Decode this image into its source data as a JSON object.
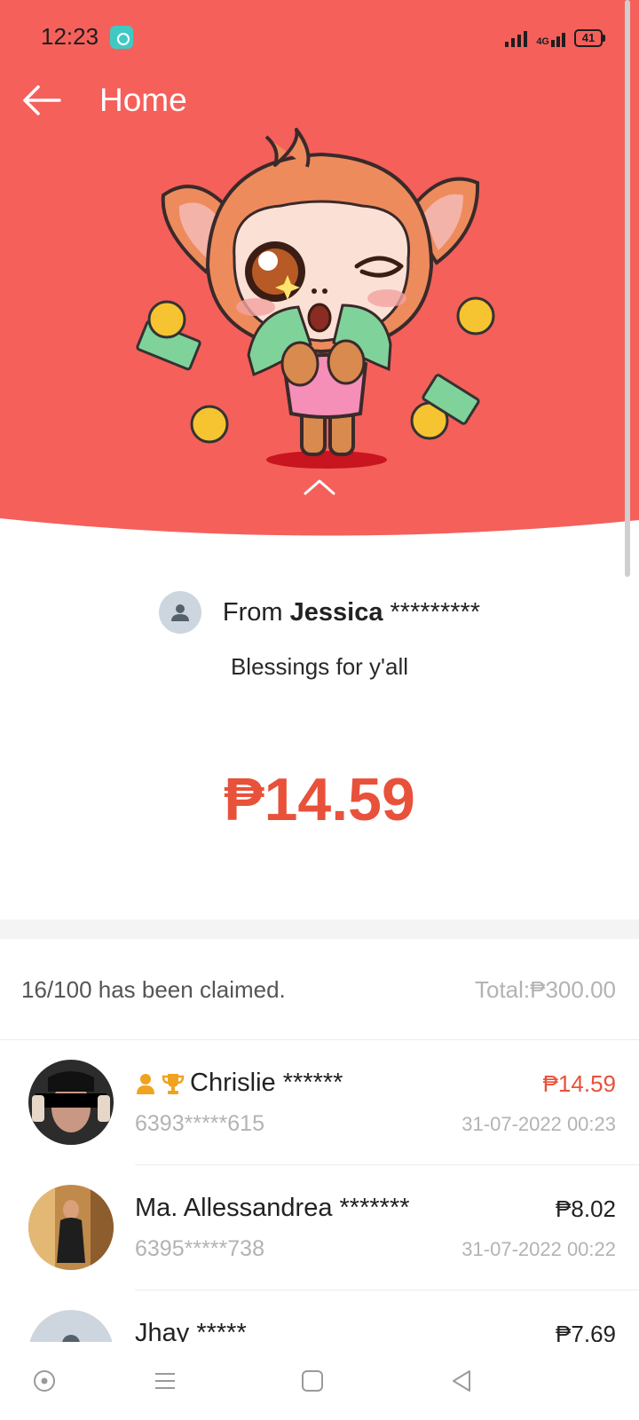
{
  "status_bar": {
    "time": "12:23",
    "network": "4G",
    "battery": "41",
    "icons": [
      "app-notification-icon",
      "signal-icon",
      "mobile-data-icon",
      "battery-icon"
    ]
  },
  "app_bar": {
    "back_icon": "arrow-left-icon",
    "title": "Home"
  },
  "hero": {
    "background_color": "#f5605b",
    "illustration": "monkey-holding-cash-icon"
  },
  "packet": {
    "from_prefix": "From",
    "sender_name": "Jessica",
    "sender_masked": "*********",
    "message": "Blessings for y'all",
    "amount": "₱14.59"
  },
  "summary": {
    "claimed": "16/100 has been claimed.",
    "total": "Total:₱300.00"
  },
  "claims": [
    {
      "name": "Chrislie ******",
      "phone": "6393*****615",
      "amount": "₱14.59",
      "time": "31-07-2022 00:23",
      "best": true,
      "badges": [
        "user-badge-icon",
        "trophy-icon"
      ]
    },
    {
      "name": "Ma. Allessandrea *******",
      "phone": "6395*****738",
      "amount": "₱8.02",
      "time": "31-07-2022 00:22",
      "best": false,
      "badges": []
    },
    {
      "name": "Jhay *****",
      "phone": "",
      "amount": "₱7.69",
      "time": "",
      "best": false,
      "badges": []
    }
  ],
  "colors": {
    "accent": "#e8513a",
    "hero": "#f5605b",
    "muted": "#b3b3b3"
  },
  "nav_bar": {
    "icons": [
      "assistant-icon",
      "menu-icon",
      "home-square-icon",
      "back-triangle-icon"
    ]
  }
}
